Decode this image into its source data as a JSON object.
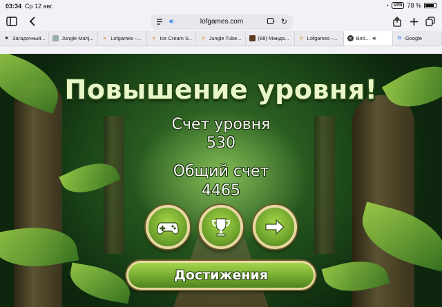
{
  "status_bar": {
    "time": "03:34",
    "date": "Ср 12 авг.",
    "vpn": "VPN",
    "battery": "78 %"
  },
  "browser": {
    "url": "lofgames.com",
    "tabs": [
      {
        "label": "Загадочный...",
        "icon": "paw-icon",
        "active": false
      },
      {
        "label": "Jungle Mahj...",
        "icon": "game-icon",
        "active": false
      },
      {
        "label": "Lofgames -...",
        "icon": "lofgames-icon",
        "active": false
      },
      {
        "label": "Ice Cream S...",
        "icon": "lofgames-icon",
        "active": false
      },
      {
        "label": "Jungle Tube...",
        "icon": "lofgames-icon",
        "active": false
      },
      {
        "label": "(88) Манда...",
        "icon": "image-icon",
        "active": false
      },
      {
        "label": "Lofgames -...",
        "icon": "lofgames-icon",
        "active": false
      },
      {
        "label": "Bird...",
        "icon": "close-icon",
        "active": true
      },
      {
        "label": "Google",
        "icon": "google-icon",
        "active": false
      }
    ]
  },
  "game": {
    "title": "Повышение уровня!",
    "level_score_label": "Счет уровня",
    "level_score_value": "530",
    "total_score_label": "Общий счет",
    "total_score_value": "4465",
    "achievements_label": "Достижения",
    "buttons": [
      "gamepad-icon",
      "trophy-icon",
      "arrow-right-icon"
    ]
  }
}
